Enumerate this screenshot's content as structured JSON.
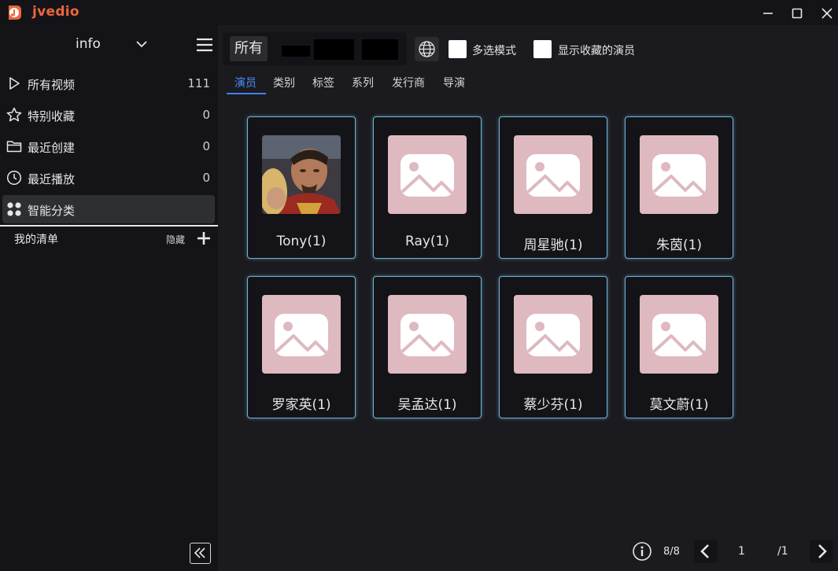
{
  "app": {
    "name": "jvedio"
  },
  "sidebar": {
    "library": "info",
    "items": [
      {
        "label": "所有视频",
        "count": "111",
        "icon": "play-icon"
      },
      {
        "label": "特别收藏",
        "count": "0",
        "icon": "star-icon"
      },
      {
        "label": "最近创建",
        "count": "0",
        "icon": "folder-icon"
      },
      {
        "label": "最近播放",
        "count": "0",
        "icon": "clock-icon"
      },
      {
        "label": "智能分类",
        "count": "",
        "icon": "grid-icon",
        "active": true
      }
    ],
    "list_title": "我的清单",
    "list_hide": "隐藏"
  },
  "toolbar": {
    "filter_all": "所有",
    "multi_select_label": "多选模式",
    "show_fav_actors_label": "显示收藏的演员",
    "multi_select_checked": false,
    "show_fav_actors_checked": false
  },
  "tabs": [
    {
      "label": "演员",
      "active": true
    },
    {
      "label": "类别"
    },
    {
      "label": "标签"
    },
    {
      "label": "系列"
    },
    {
      "label": "发行商"
    },
    {
      "label": "导演"
    }
  ],
  "actors": [
    {
      "name": "Tony(1)",
      "has_photo": true
    },
    {
      "name": "Ray(1)"
    },
    {
      "name": "周星驰(1)"
    },
    {
      "name": "朱茵(1)"
    },
    {
      "name": "罗家英(1)"
    },
    {
      "name": "吴孟达(1)"
    },
    {
      "name": "蔡少芬(1)"
    },
    {
      "name": "莫文蔚(1)"
    }
  ],
  "pager": {
    "count": "8/8",
    "page": "1",
    "total": "/1"
  },
  "colors": {
    "accent": "#3c82f6",
    "brand": "#e9683b",
    "placeholder": "#deb9c0",
    "card_border": "#6db5d6"
  }
}
